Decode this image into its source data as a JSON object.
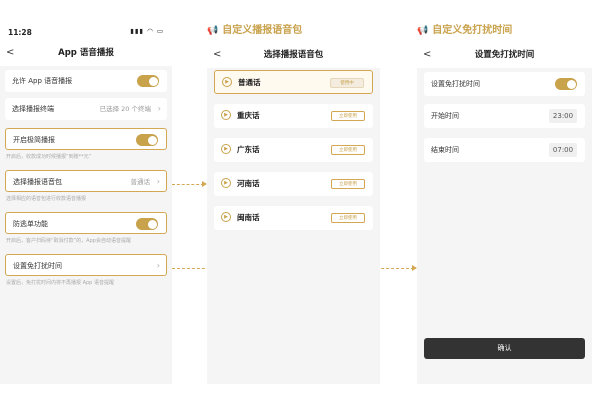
{
  "callouts": {
    "voice_pack": "自定义播报语音包",
    "dnd_time": "自定义免打扰时间"
  },
  "screen1": {
    "status_time": "11:28",
    "title": "App 语音播报",
    "rows": {
      "allow_voice": "允许 App 语音播报",
      "select_terminal": "选择播报终端",
      "select_terminal_value": "已选择 20 个终端",
      "simple_mode": "开启极简播报",
      "simple_mode_hint": "开启后，收款成功时候播报“到账**元”",
      "voice_pack": "选择播报语音包",
      "voice_pack_value": "普通话",
      "voice_pack_hint": "选择相应的语音包进行收款语音播报",
      "anti_drop": "防逃单功能",
      "anti_drop_hint": "开启后，客户扫码待“取消付款”的，App会自动语音提醒",
      "dnd": "设置免打扰时间",
      "dnd_hint": "设置后，免打扰时间内将不再播报 App 语音提醒"
    }
  },
  "screen2": {
    "title": "选择播报语音包",
    "voices": [
      {
        "name": "普通话",
        "button": "使用中"
      },
      {
        "name": "重庆话",
        "button": "立即使用"
      },
      {
        "name": "广东话",
        "button": "立即使用"
      },
      {
        "name": "河南话",
        "button": "立即使用"
      },
      {
        "name": "闽南话",
        "button": "立即使用"
      }
    ]
  },
  "screen3": {
    "title": "设置免打扰时间",
    "set_dnd": "设置免打扰时间",
    "start_label": "开始时间",
    "start_value": "23:00",
    "end_label": "结束时间",
    "end_value": "07:00",
    "confirm": "确认"
  },
  "colors": {
    "accent": "#c9a24c",
    "highlight_border": "#d4a853",
    "button_dark": "#333333"
  },
  "icons": [
    "back-icon",
    "chevron-right-icon",
    "megaphone-icon",
    "play-icon",
    "signal-icon",
    "wifi-icon",
    "battery-icon"
  ]
}
